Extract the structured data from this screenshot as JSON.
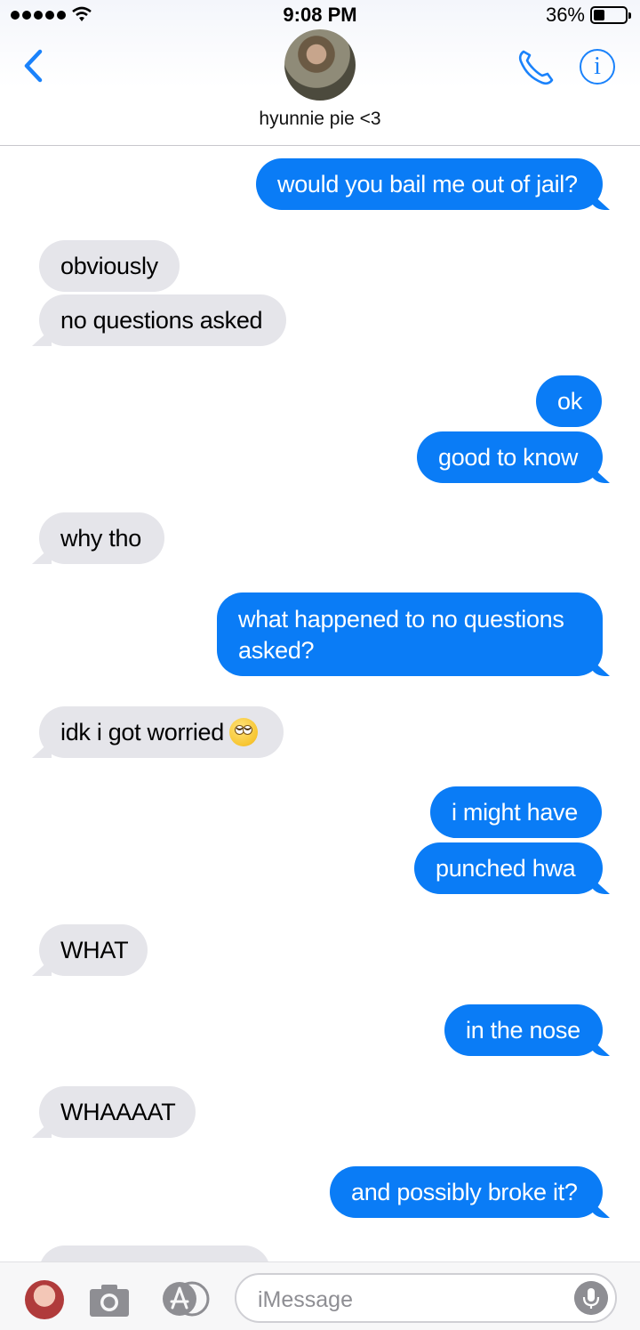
{
  "status_bar": {
    "time": "9:08 PM",
    "battery_percent": "36%",
    "battery_level": 0.36,
    "signal_dots": 5
  },
  "header": {
    "contact_name": "hyunnie pie <3"
  },
  "messages": [
    {
      "from": "me",
      "text": "would you bail me out of jail?"
    },
    {
      "from": "them",
      "text": "obviously"
    },
    {
      "from": "them",
      "text": "no questions asked"
    },
    {
      "from": "me",
      "text": "ok"
    },
    {
      "from": "me",
      "text": "good to know"
    },
    {
      "from": "them",
      "text": "why tho"
    },
    {
      "from": "me",
      "text": "what happened to no questions asked?"
    },
    {
      "from": "them",
      "text": "idk i got worried",
      "emoji": "face-with-rolling-eyes"
    },
    {
      "from": "me",
      "text": "i might have"
    },
    {
      "from": "me",
      "text": "punched hwa"
    },
    {
      "from": "them",
      "text": "WHAT"
    },
    {
      "from": "me",
      "text": "in the nose"
    },
    {
      "from": "them",
      "text": "WHAAAAT"
    },
    {
      "from": "me",
      "text": "and possibly broke it?"
    }
  ],
  "composer": {
    "placeholder": "iMessage"
  },
  "colors": {
    "accent": "#0a7cf6",
    "incoming": "#e5e5ea",
    "icon_blue": "#1a82fb"
  },
  "icons": [
    "back-chevron-icon",
    "phone-icon",
    "info-icon",
    "camera-icon",
    "app-store-icon",
    "microphone-icon"
  ]
}
